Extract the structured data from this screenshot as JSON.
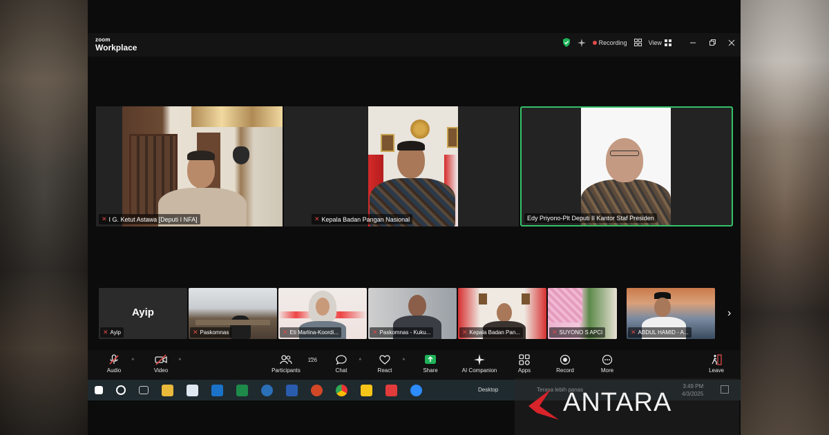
{
  "app": {
    "brand_top": "zoom",
    "brand_bottom": "Workplace",
    "recording_label": "Recording",
    "view_label": "View"
  },
  "main_tiles": [
    {
      "name": "I G. Ketut Astawa [Deputi I NFA]"
    },
    {
      "name": "Kepala Badan Pangan Nasional"
    },
    {
      "name": "Edy Priyono-Plt Deputi II Kantor Staf Presiden"
    }
  ],
  "strip": {
    "ayip_label": "Ayip",
    "thumbs": [
      {
        "name": "Ayip"
      },
      {
        "name": "Paskomnas"
      },
      {
        "name": "Eti Marlina-Koordi..."
      },
      {
        "name": "Paskomnas - Kuku..."
      },
      {
        "name": "Kepala Badan Pan..."
      },
      {
        "name": "SUYONO S APCI"
      },
      {
        "name": "ABDUL HAMID - A..."
      }
    ]
  },
  "toolbar": {
    "audio": "Audio",
    "video": "Video",
    "participants": "Participants",
    "participants_count": "126",
    "chat": "Chat",
    "react": "React",
    "share": "Share",
    "ai_companion": "AI Companion",
    "apps": "Apps",
    "record": "Record",
    "more": "More",
    "leave": "Leave"
  },
  "taskbar": {
    "desktop_label": "Desktop",
    "weather_text": "Terasa lebih panas",
    "time": "3:49 PM",
    "date": "4/3/2025"
  },
  "watermark": {
    "text": "ANTARA"
  },
  "colors": {
    "active_speaker_border": "#35c26a",
    "recording_dot": "#e24a4a",
    "share_green": "#1fb35a",
    "watermark_red": "#d8232a"
  }
}
